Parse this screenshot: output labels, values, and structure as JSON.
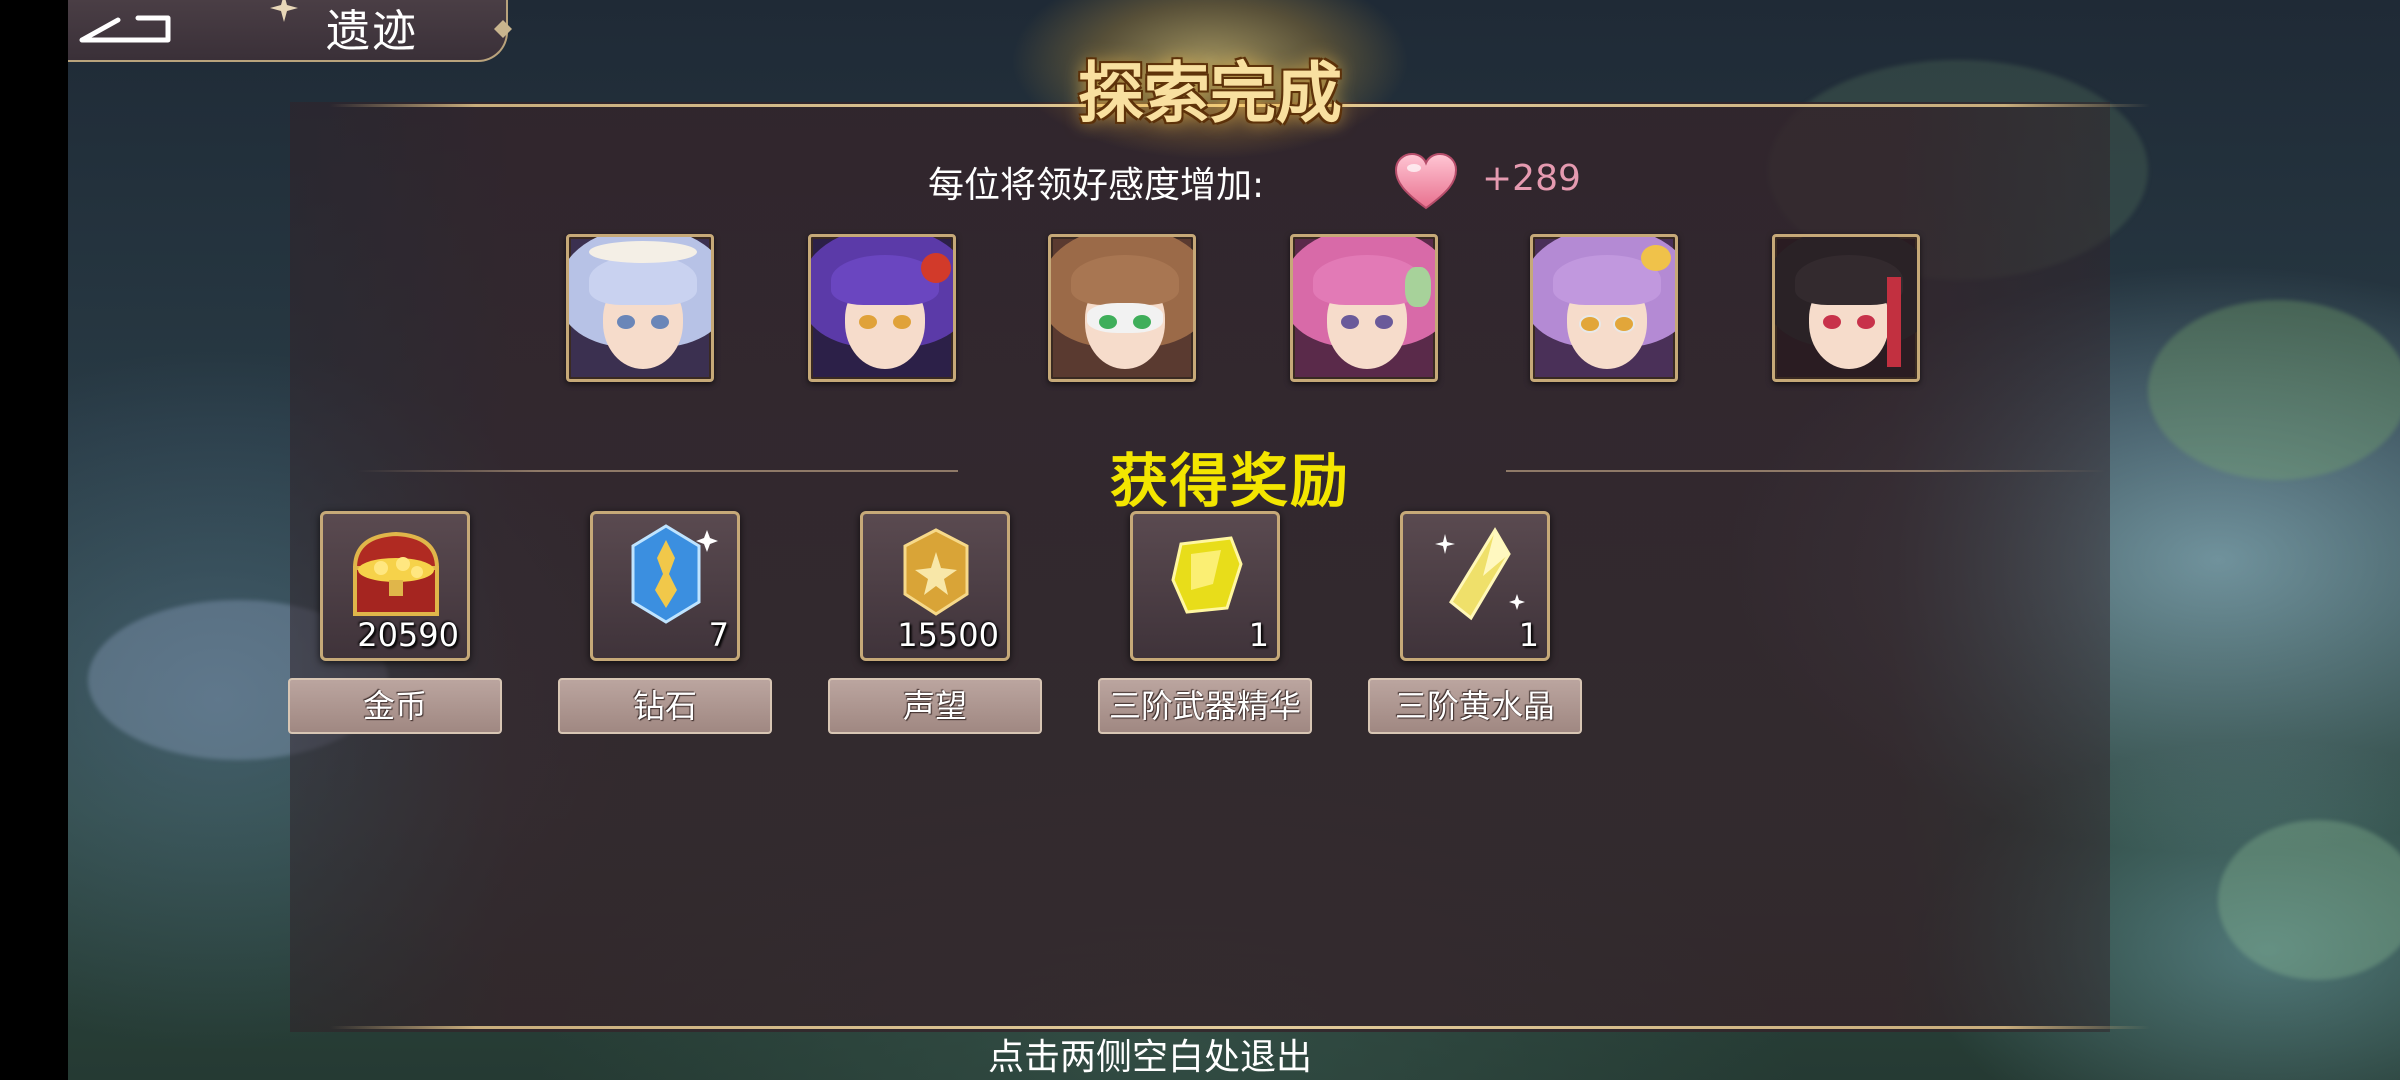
{
  "header": {
    "title": "遗迹",
    "back_icon": "back-arrow-icon"
  },
  "banner": {
    "title": "探索完成"
  },
  "affection": {
    "label": "每位将领好感度增加:",
    "icon": "heart-icon",
    "value": "+289",
    "color": "#e59ab0"
  },
  "heroes": [
    {
      "name": "hero-portrait-1"
    },
    {
      "name": "hero-portrait-2"
    },
    {
      "name": "hero-portrait-3"
    },
    {
      "name": "hero-portrait-4"
    },
    {
      "name": "hero-portrait-5"
    },
    {
      "name": "hero-portrait-6"
    }
  ],
  "rewards": {
    "title": "获得奖励",
    "title_color": "#f3e600",
    "items": [
      {
        "label": "金币",
        "quantity": "20590",
        "icon": "treasure-chest-icon"
      },
      {
        "label": "钻石",
        "quantity": "7",
        "icon": "blue-crystal-icon"
      },
      {
        "label": "声望",
        "quantity": "15500",
        "icon": "gold-medal-icon"
      },
      {
        "label": "三阶武器精华",
        "quantity": "1",
        "icon": "yellow-essence-icon"
      },
      {
        "label": "三阶黄水晶",
        "quantity": "1",
        "icon": "yellow-crystal-icon"
      }
    ]
  },
  "footer": {
    "hint": "点击两侧空白处退出"
  }
}
